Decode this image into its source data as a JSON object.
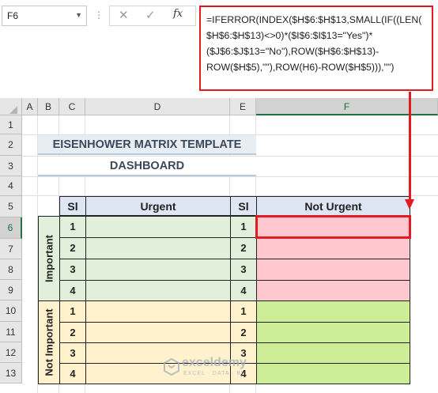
{
  "formula_bar": {
    "name_box": "F6",
    "dots": "⋮",
    "cancel_icon": "close-icon",
    "enter_icon": "check-icon",
    "fx_label": "fx",
    "formula": "=IFERROR(INDEX($H$6:$H$13,SMALL(IF((LEN(\n$H$6:$H$13)<>0)*($I$6:$I$13=\"Yes\")*\n($J$6:$J$13=\"No\"),ROW($H$6:$H$13)-\nROW($H$5),\"\"),ROW(H6)-ROW($H$5))),\"\")"
  },
  "columns": [
    "A",
    "B",
    "C",
    "D",
    "E",
    "F"
  ],
  "rows": [
    "1",
    "2",
    "3",
    "4",
    "5",
    "6",
    "7",
    "8",
    "9",
    "10",
    "11",
    "12",
    "13"
  ],
  "title": {
    "line1": "EISENHOWER MATRIX TEMPLATE",
    "line2": "DASHBOARD"
  },
  "table": {
    "headers": {
      "sl1": "Sl",
      "urgent": "Urgent",
      "sl2": "Sl",
      "not_urgent": "Not Urgent"
    },
    "important_label": "Important",
    "not_important_label": "Not Important",
    "important_sl": [
      "1",
      "2",
      "3",
      "4"
    ],
    "not_important_sl": [
      "1",
      "2",
      "3",
      "4"
    ]
  },
  "colors": {
    "urgent_important": "#e2efda",
    "urgent_not_important": "#fff2cc",
    "not_urgent_important": "#ffc7ce",
    "not_urgent_not_important": "#cdee96",
    "highlight": "#e21b23"
  },
  "watermark": {
    "name": "exceldemy",
    "tagline": "EXCEL · DATA · BI"
  }
}
